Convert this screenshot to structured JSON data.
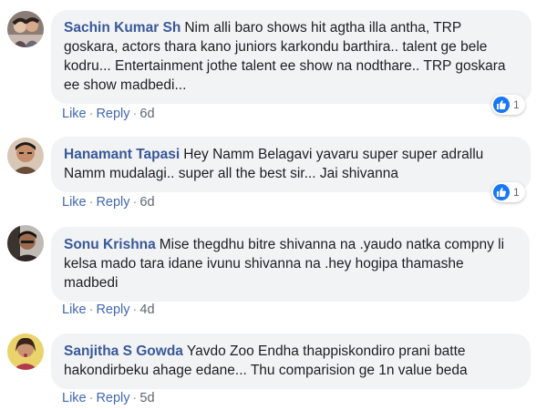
{
  "comments": [
    {
      "author": "Sachin Kumar Sh",
      "text": "Nim alli baro shows hit agtha illa antha, TRP goskara, actors thara kano juniors karkondu barthira.. talent ge bele kodru... Entertainment jothe talent ee show na nodthare.. TRP goskara ee show madbedi...",
      "like_label": "Like",
      "reply_label": "Reply",
      "time": "6d",
      "reaction_count": "1"
    },
    {
      "author": "Hanamant Tapasi",
      "text": "Hey Namm Belagavi yavaru super super adrallu Namm mudalagi.. super all the best sir... Jai shivanna",
      "like_label": "Like",
      "reply_label": "Reply",
      "time": "6d",
      "reaction_count": "1"
    },
    {
      "author": "Sonu Krishna",
      "text": "Mise thegdhu bitre shivanna na .yaudo natka compny li kelsa mado tara idane ivunu shivanna na .hey hogipa thamashe madbedi",
      "like_label": "Like",
      "reply_label": "Reply",
      "time": "4d"
    },
    {
      "author": "Sanjitha S Gowda",
      "text": "Yavdo Zoo Endha thappiskondiro prani batte hakondirbeku ahage edane... Thu comparision ge 1n value beda",
      "like_label": "Like",
      "reply_label": "Reply",
      "time": "5d"
    }
  ],
  "colors": {
    "author": "#385898",
    "link": "#4267b2",
    "bubble": "#f2f3f5",
    "reaction": "#1877f2"
  },
  "icons": [
    "avatar",
    "like-icon"
  ]
}
